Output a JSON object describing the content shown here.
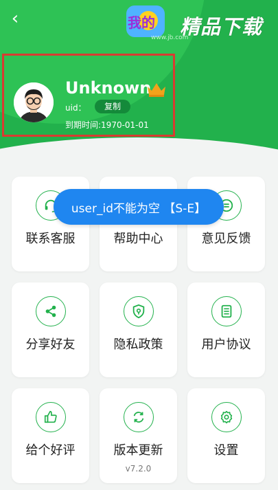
{
  "header": {
    "watermark_text": "精品下载",
    "watermark_badge_text": "我的",
    "watermark_url": "www.jb.com"
  },
  "profile": {
    "username": "Unknown",
    "uid_label": "uid：",
    "copy_label": "复制",
    "expire_text": "到期时间:1970-01-01"
  },
  "toast": {
    "message": "user_id不能为空 【S-E】"
  },
  "menu": [
    {
      "label": "联系客服",
      "icon": "headset-icon"
    },
    {
      "label": "帮助中心",
      "icon": "help-icon"
    },
    {
      "label": "意见反馈",
      "icon": "feedback-icon"
    },
    {
      "label": "分享好友",
      "icon": "share-icon"
    },
    {
      "label": "隐私政策",
      "icon": "privacy-shield-icon"
    },
    {
      "label": "用户协议",
      "icon": "document-icon"
    },
    {
      "label": "给个好评",
      "icon": "thumbs-up-icon"
    },
    {
      "label": "版本更新",
      "icon": "refresh-icon",
      "sub": "v7.2.0"
    },
    {
      "label": "设置",
      "icon": "settings-gear-icon"
    }
  ],
  "colors": {
    "brand_green": "#22b14c",
    "toast_blue": "#1f86f0",
    "highlight_red": "#d93b31"
  }
}
